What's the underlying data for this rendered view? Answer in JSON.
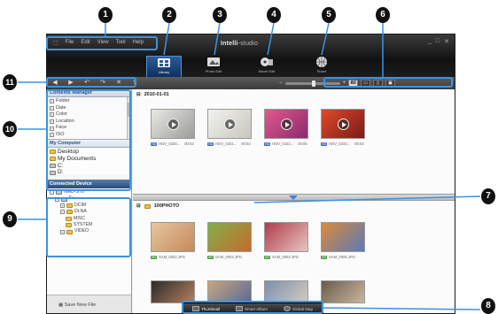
{
  "menu": {
    "items": [
      "File",
      "Edit",
      "View",
      "Tool",
      "Help"
    ]
  },
  "app": {
    "title_bold": "Intelli",
    "title_rest": "-studio"
  },
  "window_controls": [
    "_",
    "□",
    "✕"
  ],
  "modes": [
    {
      "label": "Library",
      "icon": "library-icon",
      "active": true
    },
    {
      "label": "Photo Edit",
      "icon": "photo-edit-icon",
      "active": false
    },
    {
      "label": "Movie Edit",
      "icon": "movie-edit-icon",
      "active": false
    },
    {
      "label": "Share",
      "icon": "share-globe-icon",
      "active": false
    }
  ],
  "view_buttons": [
    {
      "label": "All",
      "active": true
    },
    {
      "label": "▭",
      "active": false
    },
    {
      "label": "▯",
      "active": false
    },
    {
      "label": "▣",
      "active": false
    }
  ],
  "contents_manager": {
    "title": "Contents Manager",
    "items": [
      "Folder",
      "Date",
      "Color",
      "Location",
      "Face",
      "ISO",
      "Shutter Speed",
      "F-Number"
    ]
  },
  "my_computer": {
    "title": "My Computer",
    "items": [
      "Desktop",
      "My Documents",
      "C:",
      "D:"
    ]
  },
  "connected_device": {
    "title": "Connected Device",
    "items": [
      {
        "label": "NMD-S70",
        "level": 0
      },
      {
        "label": "E:",
        "level": 1
      },
      {
        "label": "DCIM",
        "level": 2
      },
      {
        "label": "DLNA",
        "level": 2
      },
      {
        "label": "MISC",
        "level": 3
      },
      {
        "label": "SYSTEM",
        "level": 3
      },
      {
        "label": "VIDEO",
        "level": 2
      }
    ]
  },
  "save_new_file": "Save New File",
  "group1": {
    "date": "2010-01-01",
    "items": [
      {
        "badge": "HD",
        "name": "HDV_0230...",
        "time": "00:02",
        "palette": [
          "#e8e8e4",
          "#9c9c99"
        ]
      },
      {
        "badge": "HD",
        "name": "HDV_0231...",
        "time": "00:02",
        "palette": [
          "#f1f1ee",
          "#c8c6bf"
        ]
      },
      {
        "badge": "HD",
        "name": "HDV_0232...",
        "time": "00:05",
        "palette": [
          "#e25a8c",
          "#8a2a6e"
        ]
      },
      {
        "badge": "HD",
        "name": "HDV_0233...",
        "time": "00:02",
        "palette": [
          "#e04a2a",
          "#7a1b18"
        ]
      }
    ]
  },
  "group2": {
    "folder": "100PHOTO",
    "items": [
      {
        "badge": "SR",
        "name": "SAM_0002.JPG",
        "palette": [
          "#e8c6a0",
          "#c48a5a"
        ]
      },
      {
        "badge": "SR",
        "name": "SAM_0003.JPG",
        "palette": [
          "#7fb04a",
          "#c86a2a"
        ]
      },
      {
        "badge": "SR",
        "name": "SAM_0004.JPG",
        "palette": [
          "#b23a4a",
          "#e5c6c2"
        ]
      },
      {
        "badge": "SR",
        "name": "SAM_0005.JPG",
        "palette": [
          "#dd8a3a",
          "#5a7ab8"
        ]
      }
    ],
    "more_palettes": [
      [
        "#2a2a2a",
        "#b58060"
      ],
      [
        "#c9a67c",
        "#5a6a9a"
      ],
      [
        "#7a8fb0",
        "#d6cbb8"
      ],
      [
        "#6a5a4a",
        "#c8b8a0"
      ]
    ]
  },
  "bottom_tabs": [
    {
      "label": "Thumbnail",
      "active": true
    },
    {
      "label": "Smart Album",
      "active": false
    },
    {
      "label": "Global Map",
      "active": false
    }
  ],
  "callouts": [
    "1",
    "2",
    "3",
    "4",
    "5",
    "6",
    "7",
    "8",
    "9",
    "10",
    "11"
  ],
  "colors": {
    "callout_line": "#3a93e1",
    "accent": "#3d7fd6"
  }
}
